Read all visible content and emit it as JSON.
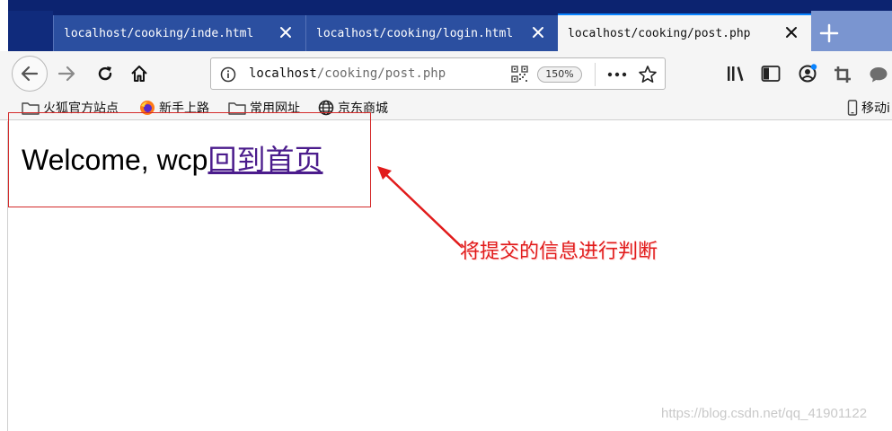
{
  "tabs": [
    {
      "title": "localhost/cooking/inde.html",
      "active": false
    },
    {
      "title": "localhost/cooking/login.html",
      "active": false
    },
    {
      "title": "localhost/cooking/post.php",
      "active": true
    }
  ],
  "navbar": {
    "url_host": "localhost",
    "url_path": "/cooking/post.php",
    "zoom": "150%"
  },
  "bookmarks": {
    "items": [
      {
        "label": "火狐官方站点",
        "icon": "folder-icon"
      },
      {
        "label": "新手上路",
        "icon": "firefox-icon"
      },
      {
        "label": "常用网址",
        "icon": "folder-icon"
      },
      {
        "label": "京东商城",
        "icon": "globe-icon"
      }
    ],
    "mobile_label": "移动i"
  },
  "page": {
    "welcome_text": "Welcome, wcp",
    "home_link": "回到首页"
  },
  "annotation": {
    "text": "将提交的信息进行判断",
    "color": "#e11b1b"
  },
  "watermark": "https://blog.csdn.net/qq_41901122",
  "colors": {
    "tab_strip": "#0c2370",
    "active_tab": "#f5f5f5",
    "accent": "#0a84ff",
    "link_visited": "#4b1c8c",
    "annotation_red": "#e11b1b"
  }
}
